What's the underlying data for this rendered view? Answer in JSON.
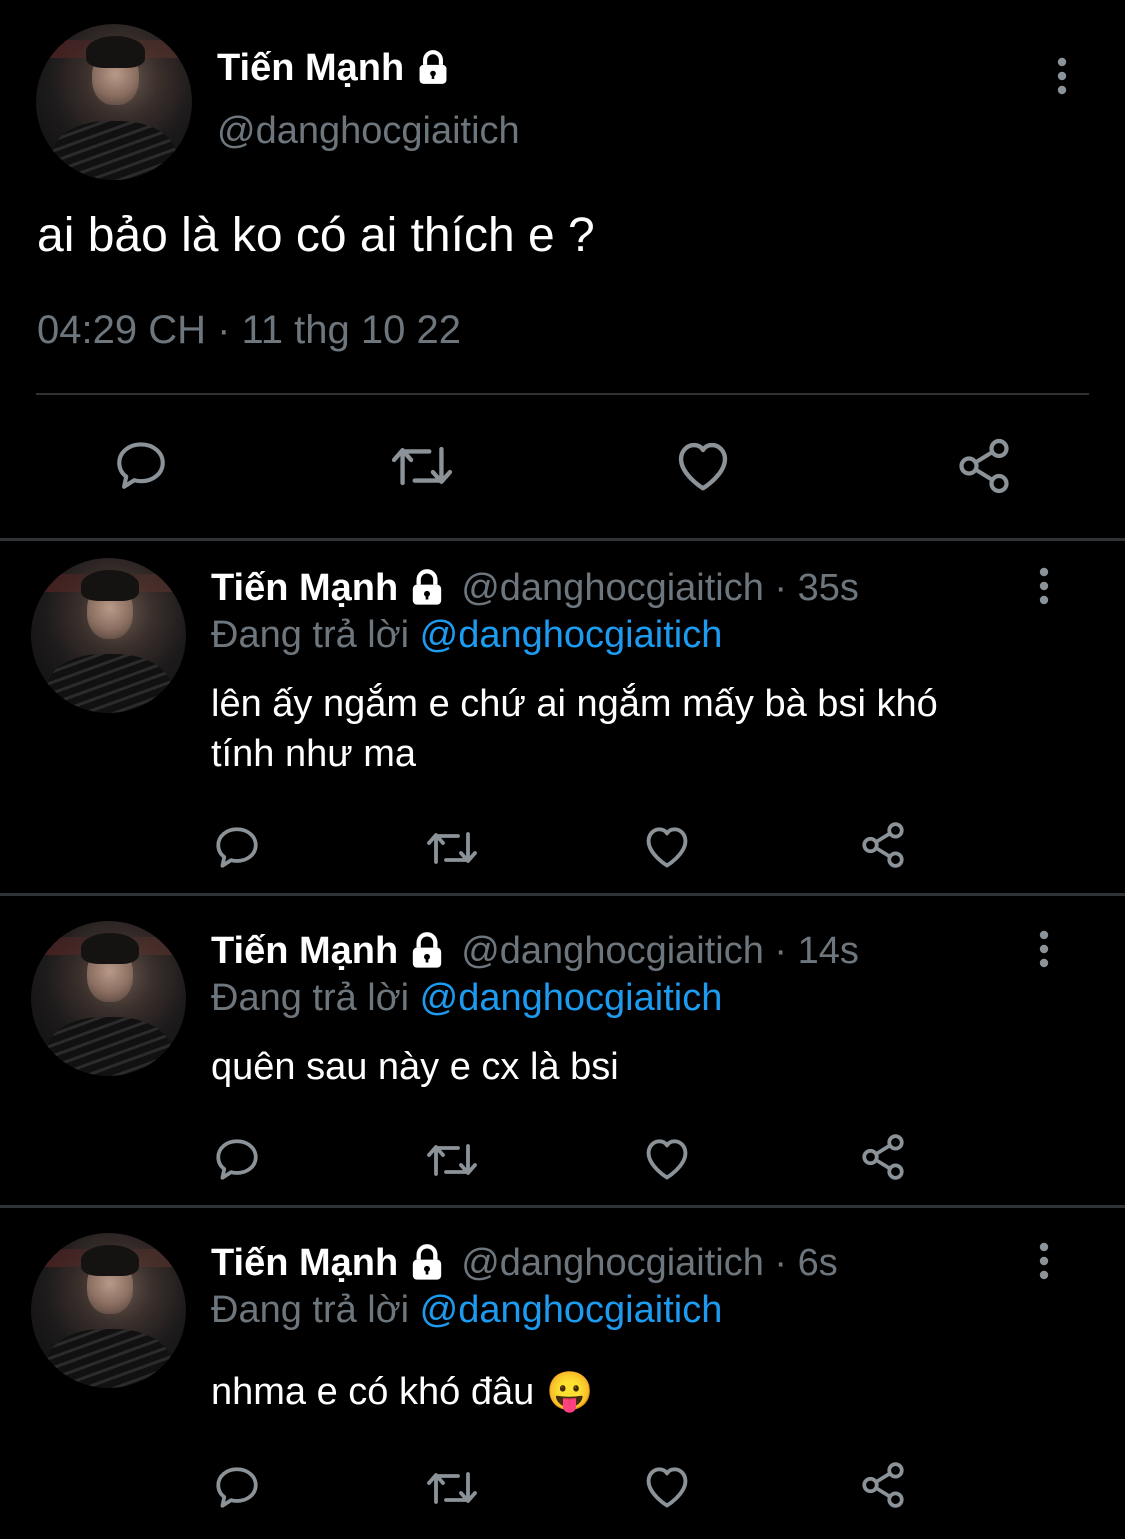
{
  "main_tweet": {
    "display_name": "Tiến Mạnh",
    "handle": "@danghocgiaitich",
    "text": "ai bảo là ko có ai thích e ?",
    "timestamp": "04:29 CH · 11 thg 10 22"
  },
  "replies": [
    {
      "display_name": "Tiến Mạnh",
      "handle_time": "@danghocgiaitich · 35s",
      "replying_prefix": "Đang trả lời",
      "replying_to": "@danghocgiaitich",
      "text_line1": "lên ấy ngắm e chứ ai ngắm mấy bà bsi khó",
      "text_line2": "tính như ma"
    },
    {
      "display_name": "Tiến Mạnh",
      "handle_time": "@danghocgiaitich · 14s",
      "replying_prefix": "Đang trả lời",
      "replying_to": "@danghocgiaitich",
      "text_line1": "quên sau này e cx là bsi"
    },
    {
      "display_name": "Tiến Mạnh",
      "handle_time": "@danghocgiaitich · 6s",
      "replying_prefix": "Đang trả lời",
      "replying_to": "@danghocgiaitich",
      "text_line1": "nhma e có khó đâu",
      "emoji": "😛"
    }
  ],
  "icons": [
    "lock-icon",
    "more-icon",
    "reply-icon",
    "retweet-icon",
    "like-icon",
    "share-icon"
  ],
  "colors": {
    "background": "#000000",
    "text": "#ffffff",
    "muted": "#6e767d",
    "link": "#1d9bf0",
    "divider": "#2f3336"
  }
}
